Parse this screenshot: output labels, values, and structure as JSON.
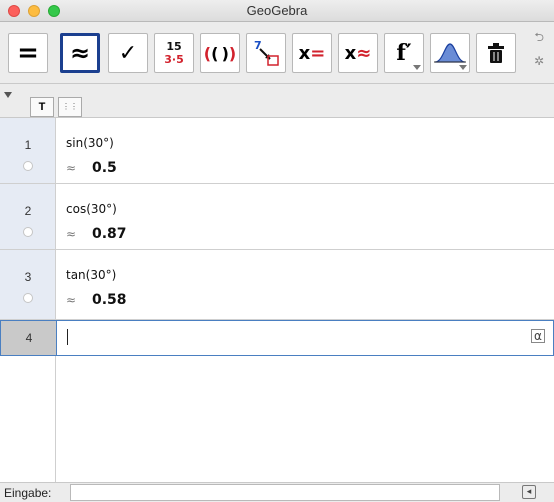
{
  "window": {
    "title": "GeoGebra"
  },
  "toolbar": {
    "tools": [
      {
        "name": "evaluate",
        "symbol": "="
      },
      {
        "name": "numeric",
        "symbol": "≈",
        "selected": true
      },
      {
        "name": "keep-input",
        "symbol": "✓"
      },
      {
        "name": "factor-number",
        "top": "15",
        "bottom": "3·5"
      },
      {
        "name": "expand",
        "symbol": "(( ))"
      },
      {
        "name": "substitute",
        "symbol": "7"
      },
      {
        "name": "solve",
        "symbol": "x="
      },
      {
        "name": "solve-numerically",
        "symbol": "x≈"
      },
      {
        "name": "derivative",
        "symbol": "f′"
      },
      {
        "name": "probability-calculator",
        "symbol": ""
      },
      {
        "name": "delete",
        "symbol": ""
      }
    ]
  },
  "tabs": {
    "text_tab": "T",
    "table_tab": "⋮⋮"
  },
  "rows": [
    {
      "index": "1",
      "expression": "sin(30°)",
      "approx_sign": "≈",
      "value": "0.5"
    },
    {
      "index": "2",
      "expression": "cos(30°)",
      "approx_sign": "≈",
      "value": "0.87"
    },
    {
      "index": "3",
      "expression": "tan(30°)",
      "approx_sign": "≈",
      "value": "0.58"
    },
    {
      "index": "4",
      "expression": "",
      "approx_sign": "",
      "value": ""
    }
  ],
  "input_bar": {
    "label": "Eingabe:",
    "value": ""
  },
  "colors": {
    "selected_border": "#1b3f8f",
    "active_row_border": "#4a7fc1",
    "row_gutter": "#e6ebf4"
  }
}
